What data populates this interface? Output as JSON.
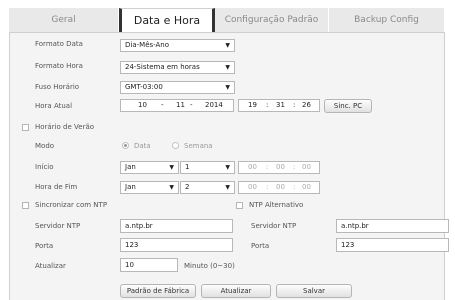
{
  "tabs": [
    {
      "label": "Geral"
    },
    {
      "label": "Data e Hora"
    },
    {
      "label": "Configuração Padrão"
    },
    {
      "label": "Backup Config"
    }
  ],
  "form": {
    "date_format": {
      "label": "Formato Data",
      "value": "Dia-Mês-Ano"
    },
    "time_format": {
      "label": "Formato Hora",
      "value": "24-Sistema em horas"
    },
    "timezone": {
      "label": "Fuso Horário",
      "value": "GMT-03:00"
    },
    "current_time": {
      "label": "Hora Atual",
      "day": "10",
      "month": "11",
      "year": "2014",
      "hour": "19",
      "minute": "31",
      "second": "26",
      "date_sep": "-",
      "time_sep": ":",
      "sync_label": "Sinc. PC"
    },
    "dst": {
      "label": "Horário de Verão",
      "checked": false,
      "mode_label": "Modo",
      "mode_options": [
        "Data",
        "Semana"
      ],
      "mode_selected": "Data",
      "start": {
        "label": "Início",
        "month": "Jan",
        "day": "1",
        "hour": "00",
        "minute": "00",
        "second": "00"
      },
      "end": {
        "label": "Hora de Fim",
        "month": "Jan",
        "day": "2",
        "hour": "00",
        "minute": "00",
        "second": "00"
      }
    },
    "ntp": {
      "label": "Sincronizar com NTP",
      "alt_label": "NTP Alternativo",
      "server_label": "Servidor NTP",
      "server": "a.ntp.br",
      "port_label": "Porta",
      "port": "123",
      "alt_server_label": "Servidor NTP",
      "alt_server": "a.ntp.br",
      "alt_port_label": "Porta",
      "alt_port": "123",
      "update_label": "Atualizar",
      "update_value": "10",
      "update_unit": "Minuto (0~30)"
    }
  },
  "buttons": {
    "factory": "Padrão de Fábrica",
    "refresh": "Atualizar",
    "save": "Salvar"
  }
}
